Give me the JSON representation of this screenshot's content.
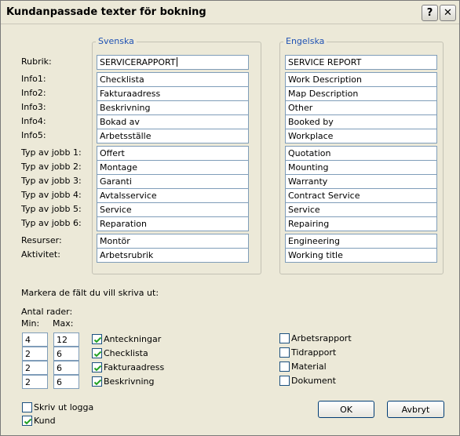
{
  "window": {
    "title": "Kundanpassade texter för bokning",
    "help_label": "?",
    "close_label": "✕"
  },
  "swedish": {
    "legend": "Svenska",
    "fields": [
      "SERVICERAPPORT",
      "Checklista",
      "Fakturaadress",
      "Beskrivning",
      "Bokad av",
      "Arbetsställe",
      "Offert",
      "Montage",
      "Garanti",
      "Avtalsservice",
      "Service",
      "Reparation",
      "Montör",
      "Arbetsrubrik"
    ]
  },
  "english": {
    "legend": "Engelska",
    "fields": [
      "SERVICE REPORT",
      "Work Description",
      "Map Description",
      "Other",
      "Booked by",
      "Workplace",
      "Quotation",
      "Mounting",
      "Warranty",
      "Contract Service",
      "Service",
      "Repairing",
      "Engineering",
      "Working title"
    ]
  },
  "row_labels": [
    "Rubrik:",
    "Info1:",
    "Info2:",
    "Info3:",
    "Info4:",
    "Info5:",
    "Typ av jobb 1:",
    "Typ av jobb 2:",
    "Typ av jobb 3:",
    "Typ av jobb 4:",
    "Typ av jobb 5:",
    "Typ av jobb 6:",
    "Resurser:",
    "Aktivitet:"
  ],
  "print_section": {
    "heading": "Markera de fält du vill skriva ut:",
    "rows_label": "Antal rader:",
    "min_label": "Min:",
    "max_label": "Max:",
    "rows": [
      {
        "min": "4",
        "max": "12",
        "label": "Anteckningar",
        "checked": true
      },
      {
        "min": "2",
        "max": "6",
        "label": "Checklista",
        "checked": true
      },
      {
        "min": "2",
        "max": "6",
        "label": "Fakturaadress",
        "checked": true
      },
      {
        "min": "2",
        "max": "6",
        "label": "Beskrivning",
        "checked": true
      }
    ],
    "right_checks": [
      {
        "label": "Arbetsrapport",
        "checked": false
      },
      {
        "label": "Tidrapport",
        "checked": false
      },
      {
        "label": "Material",
        "checked": false
      },
      {
        "label": "Dokument",
        "checked": false
      }
    ]
  },
  "bottom_checks": [
    {
      "label": "Skriv ut logga",
      "checked": false
    },
    {
      "label": "Kund",
      "checked": true
    }
  ],
  "buttons": {
    "ok": "OK",
    "cancel": "Avbryt"
  },
  "colors": {
    "legend": "#1f52b4",
    "dialog_bg": "#ece9d8",
    "field_border": "#7f9db9",
    "check_mark": "#21a121"
  }
}
